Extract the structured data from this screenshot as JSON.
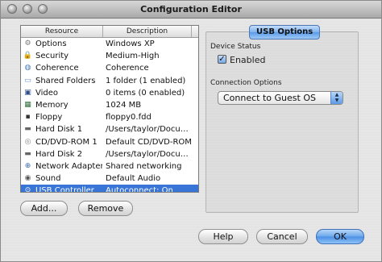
{
  "window": {
    "title": "Configuration Editor"
  },
  "resources": {
    "header_resource": "Resource",
    "header_description": "Description",
    "rows": [
      {
        "name": "Options",
        "description": "Windows XP",
        "icon": "gear-icon",
        "selected": false
      },
      {
        "name": "Security",
        "description": "Medium-High",
        "icon": "lock-icon",
        "selected": false
      },
      {
        "name": "Coherence",
        "description": "Coherence",
        "icon": "coherence-icon",
        "selected": false
      },
      {
        "name": "Shared Folders",
        "description": "1 folder (1 enabled)",
        "icon": "folder-icon",
        "selected": false
      },
      {
        "name": "Video",
        "description": "0 items (0 enabled)",
        "icon": "monitor-icon",
        "selected": false
      },
      {
        "name": "Memory",
        "description": "1024 MB",
        "icon": "memory-chip-icon",
        "selected": false
      },
      {
        "name": "Floppy",
        "description": "floppy0.fdd",
        "icon": "floppy-icon",
        "selected": false
      },
      {
        "name": "Hard Disk 1",
        "description": "/Users/taylor/Docu…",
        "icon": "hard-disk-icon",
        "selected": false
      },
      {
        "name": "CD/DVD-ROM 1",
        "description": "Default CD/DVD-ROM",
        "icon": "cd-icon",
        "selected": false
      },
      {
        "name": "Hard Disk 2",
        "description": "/Users/taylor/Docu…",
        "icon": "hard-disk-icon",
        "selected": false
      },
      {
        "name": "Network Adapter 1",
        "description": "Shared networking",
        "icon": "network-icon",
        "selected": false
      },
      {
        "name": "Sound",
        "description": "Default Audio",
        "icon": "speaker-icon",
        "selected": false
      },
      {
        "name": "USB Controller",
        "description": "Autoconnect: On",
        "icon": "usb-icon",
        "selected": true
      }
    ]
  },
  "buttons": {
    "add": "Add...",
    "remove": "Remove",
    "help": "Help",
    "cancel": "Cancel",
    "ok": "OK"
  },
  "usb_options": {
    "tab_label": "USB Options",
    "device_status_label": "Device Status",
    "enabled_label": "Enabled",
    "enabled_checked": true,
    "connection_options_label": "Connection Options",
    "connection_value": "Connect to Guest OS"
  },
  "colors": {
    "selection": "#3875d7",
    "accent_button": "#4a8ee5"
  }
}
